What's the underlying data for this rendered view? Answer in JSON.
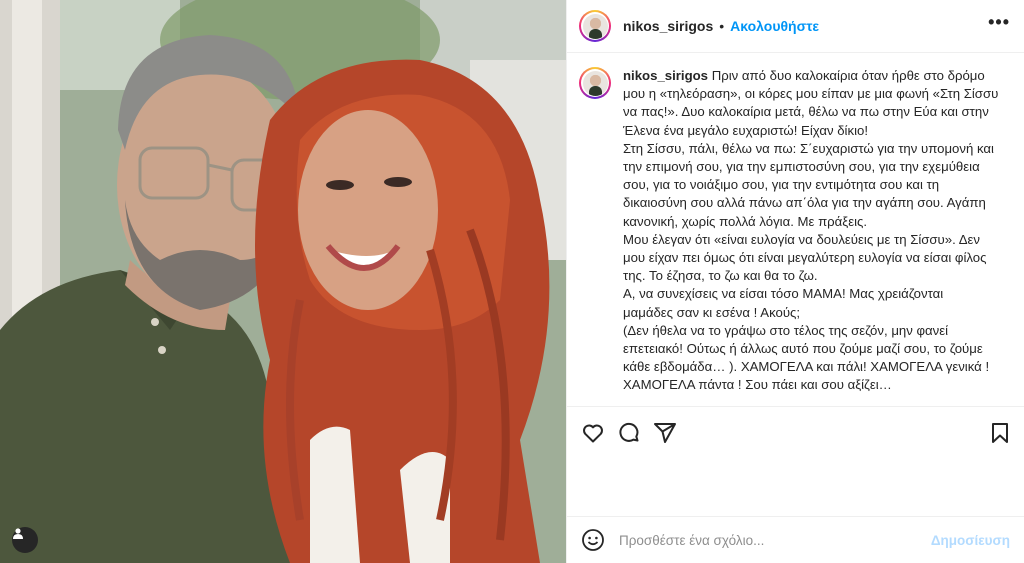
{
  "post": {
    "username": "nikos_sirigos",
    "separator": "•",
    "follow_label": "Ακολουθήστε",
    "more_label": "•••",
    "caption_lines": [
      "Πριν από δυο καλοκαίρια όταν ήρθε στο δρόμο",
      "μου η «τηλεόραση», οι κόρες μου είπαν με μια φωνή «Στη Σίσσυ",
      "να πας!». Δυο καλοκαίρια μετά, θέλω να πω στην Εύα και στην",
      "Έλενα ένα μεγάλο ευχαριστώ! Είχαν δίκιο!",
      "Στη Σίσσυ, πάλι, θέλω να πω: Σ΄ευχαριστώ για την υπομονή και",
      "την επιμονή σου, για την εμπιστοσύνη σου, για την εχεμύθεια",
      "σου, για το νοιάξιμο σου, για την εντιμότητα σου και τη",
      "δικαιοσύνη σου αλλά πάνω απ΄όλα για την αγάπη σου. Αγάπη",
      "κανονική, χωρίς πολλά λόγια. Με πράξεις.",
      "Μου έλεγαν ότι «είναι ευλογία να δουλεύεις με τη Σίσσυ». Δεν",
      "μου είχαν πει όμως ότι είναι μεγαλύτερη ευλογία να είσαι φίλος",
      "της. Το έζησα, το ζω και θα το ζω.",
      "Α, να συνεχίσεις να είσαι τόσο ΜΑΜΑ! Μας χρειάζονται",
      "μαμάδες σαν κι εσένα ! Ακούς;",
      "(Δεν ήθελα να το γράψω στο τέλος της σεζόν, μην φανεί",
      "επετειακό! Ούτως ή άλλως αυτό που ζούμε μαζί σου, το ζούμε",
      "κάθε εβδομάδα… ). ΧΑΜΟΓΕΛΑ και πάλι! ΧΑΜΟΓΕΛΑ γενικά !",
      "ΧΑΜΟΓΕΛΑ πάντα ! Σου πάει και σου αξίζει…"
    ]
  },
  "actions": {
    "like_icon": "heart-icon",
    "comment_icon": "comment-icon",
    "share_icon": "share-icon",
    "save_icon": "bookmark-icon"
  },
  "comment": {
    "placeholder": "Προσθέστε ένα σχόλιο...",
    "post_label": "Δημοσίευση",
    "emoji_icon": "emoji-icon"
  },
  "colors": {
    "follow": "#0095f6",
    "post_disabled": "#b3dbff",
    "border": "#efefef",
    "text": "#262626"
  }
}
